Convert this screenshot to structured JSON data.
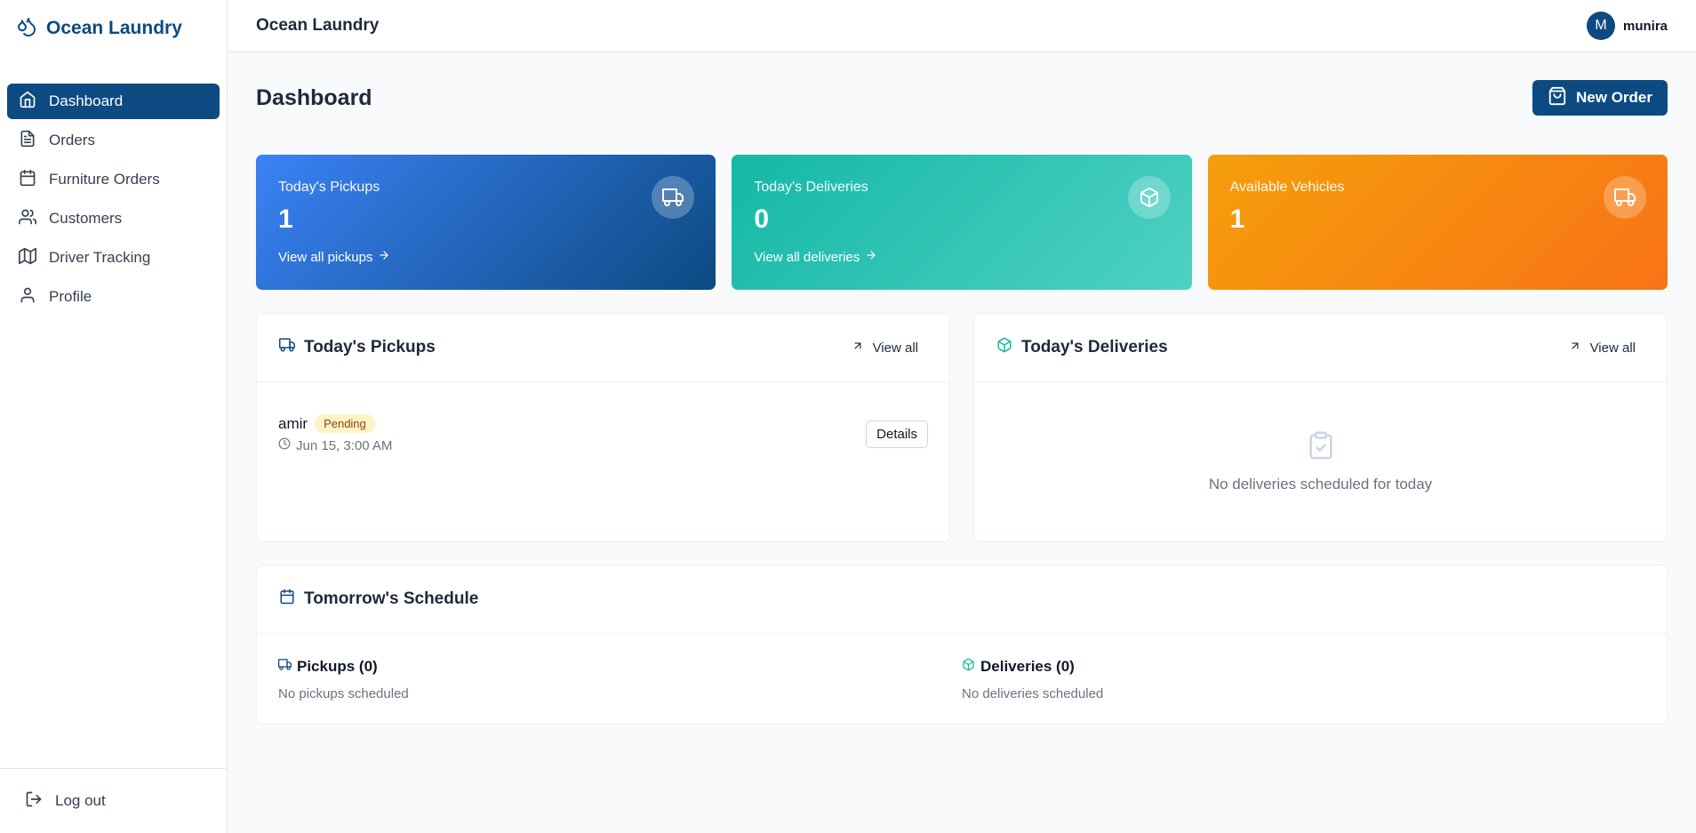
{
  "app": {
    "brand": "Ocean Laundry",
    "header_title": "Ocean Laundry"
  },
  "user": {
    "initial": "M",
    "name": "munira"
  },
  "sidebar": {
    "items": [
      {
        "label": "Dashboard",
        "icon": "home-icon",
        "active": true
      },
      {
        "label": "Orders",
        "icon": "document-icon"
      },
      {
        "label": "Furniture Orders",
        "icon": "calendar-icon"
      },
      {
        "label": "Customers",
        "icon": "users-icon"
      },
      {
        "label": "Driver Tracking",
        "icon": "map-icon"
      },
      {
        "label": "Profile",
        "icon": "user-icon"
      }
    ],
    "logout_label": "Log out"
  },
  "page": {
    "title": "Dashboard",
    "new_order_label": "New Order"
  },
  "stats": [
    {
      "label": "Today's Pickups",
      "value": "1",
      "link": "View all pickups",
      "icon": "truck-icon",
      "color": "#0d4a82"
    },
    {
      "label": "Today's Deliveries",
      "value": "0",
      "link": "View all deliveries",
      "icon": "package-icon",
      "color": "#14b8a6"
    },
    {
      "label": "Available Vehicles",
      "value": "1",
      "icon": "truck-icon",
      "color": "#f97316"
    }
  ],
  "pickups_panel": {
    "title": "Today's Pickups",
    "view_all": "View all",
    "items": [
      {
        "name": "amir",
        "status": "Pending",
        "time": "Jun 15, 3:00 AM",
        "action": "Details"
      }
    ]
  },
  "deliveries_panel": {
    "title": "Today's Deliveries",
    "view_all": "View all",
    "empty_text": "No deliveries scheduled for today"
  },
  "schedule": {
    "title": "Tomorrow's Schedule",
    "pickups_title": "Pickups (0)",
    "pickups_empty": "No pickups scheduled",
    "deliveries_title": "Deliveries (0)",
    "deliveries_empty": "No deliveries scheduled"
  },
  "colors": {
    "primary": "#0d4a82",
    "teal": "#14b8a6",
    "orange": "#f97316",
    "pending_bg": "#fef3c7"
  }
}
